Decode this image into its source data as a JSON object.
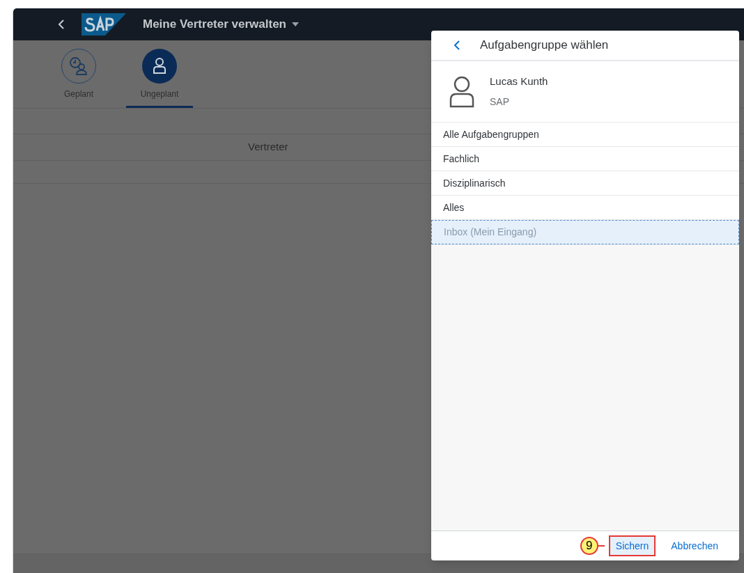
{
  "shell": {
    "title": "Meine Vertreter verwalten"
  },
  "tabs": [
    {
      "label": "Geplant",
      "kind": "scheduled",
      "selected": false
    },
    {
      "label": "Ungeplant",
      "kind": "person",
      "selected": true
    }
  ],
  "table": {
    "columns": [
      "Vertreter"
    ]
  },
  "dialog": {
    "title": "Aufgabengruppe wählen",
    "user": {
      "name": "Lucas Kunth",
      "company": "SAP"
    },
    "items": [
      {
        "label": "Alle Aufgabengruppen",
        "selected": false
      },
      {
        "label": "Fachlich",
        "selected": false
      },
      {
        "label": "Disziplinarisch",
        "selected": false
      },
      {
        "label": "Alles",
        "selected": false
      },
      {
        "label": "Inbox (Mein Eingang)",
        "selected": true
      }
    ],
    "annotation": "9",
    "buttons": [
      {
        "label": "Sichern",
        "highlighted": true
      },
      {
        "label": "Abbrechen",
        "highlighted": false
      }
    ]
  }
}
